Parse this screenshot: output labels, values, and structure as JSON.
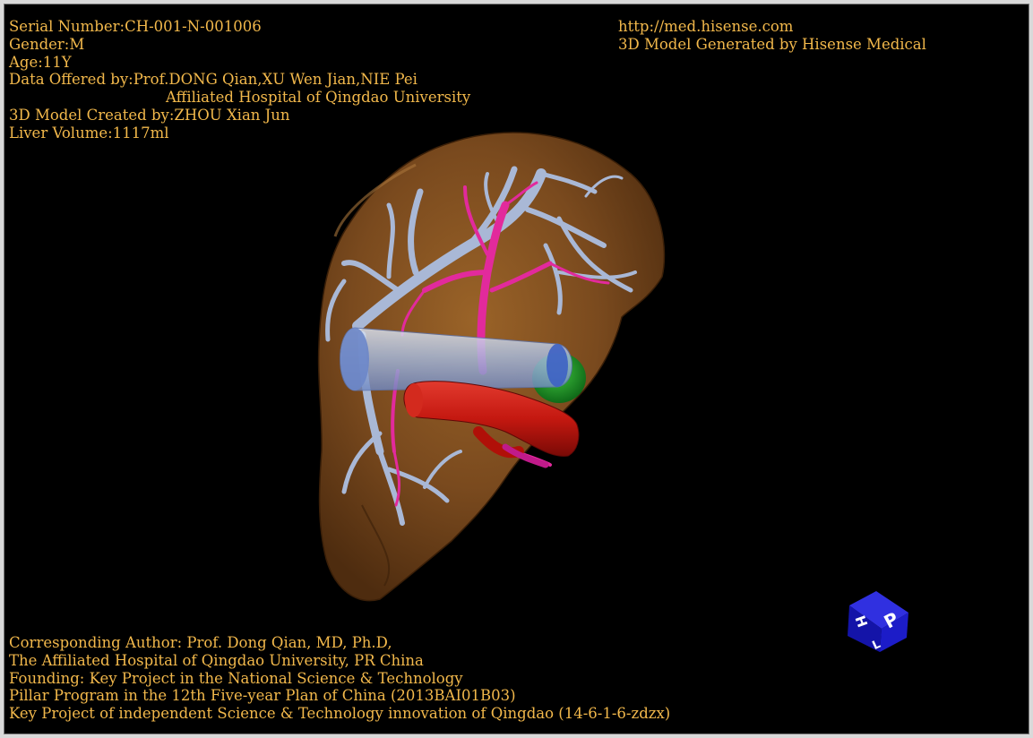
{
  "colors": {
    "background": "#000000",
    "text": "#f2b84b",
    "liver": "#7a4a1e",
    "portal_vein": "#a8b8d8",
    "hepatic_artery": "#e02a9a",
    "vena_cava": "#c81414",
    "gallbladder": "#1f9a2a",
    "orientation_cube": "#1a1ab8"
  },
  "icons": [
    "liver-3d-model",
    "orientation-cube-icon"
  ],
  "header_left": {
    "serial": "Serial Number:CH-001-N-001006",
    "gender": "Gender:M",
    "age": "Age:11Y",
    "data_offered": "Data Offered by:Prof.DONG Qian,XU Wen Jian,NIE Pei",
    "hospital": "Affiliated Hospital of Qingdao University",
    "created_by": "3D Model Created by:ZHOU Xian Jun",
    "volume": "Liver Volume:1117ml"
  },
  "header_right": {
    "url": "http://med.hisense.com",
    "generated_by": "3D Model Generated by Hisense Medical"
  },
  "footer": {
    "line1": "Corresponding Author: Prof. Dong Qian, MD, Ph.D,",
    "line2": "The Affiliated Hospital of Qingdao University, PR China",
    "line3": "Founding: Key Project in the National Science & Technology",
    "line4": "Pillar Program in the 12th Five-year Plan of China (2013BAI01B03)",
    "line5": "Key Project of independent Science & Technology innovation of Qingdao (14-6-1-6-zdzx)"
  },
  "orientation_cube": {
    "front_label": "P",
    "left_label": "H",
    "bottom_label": "L"
  }
}
